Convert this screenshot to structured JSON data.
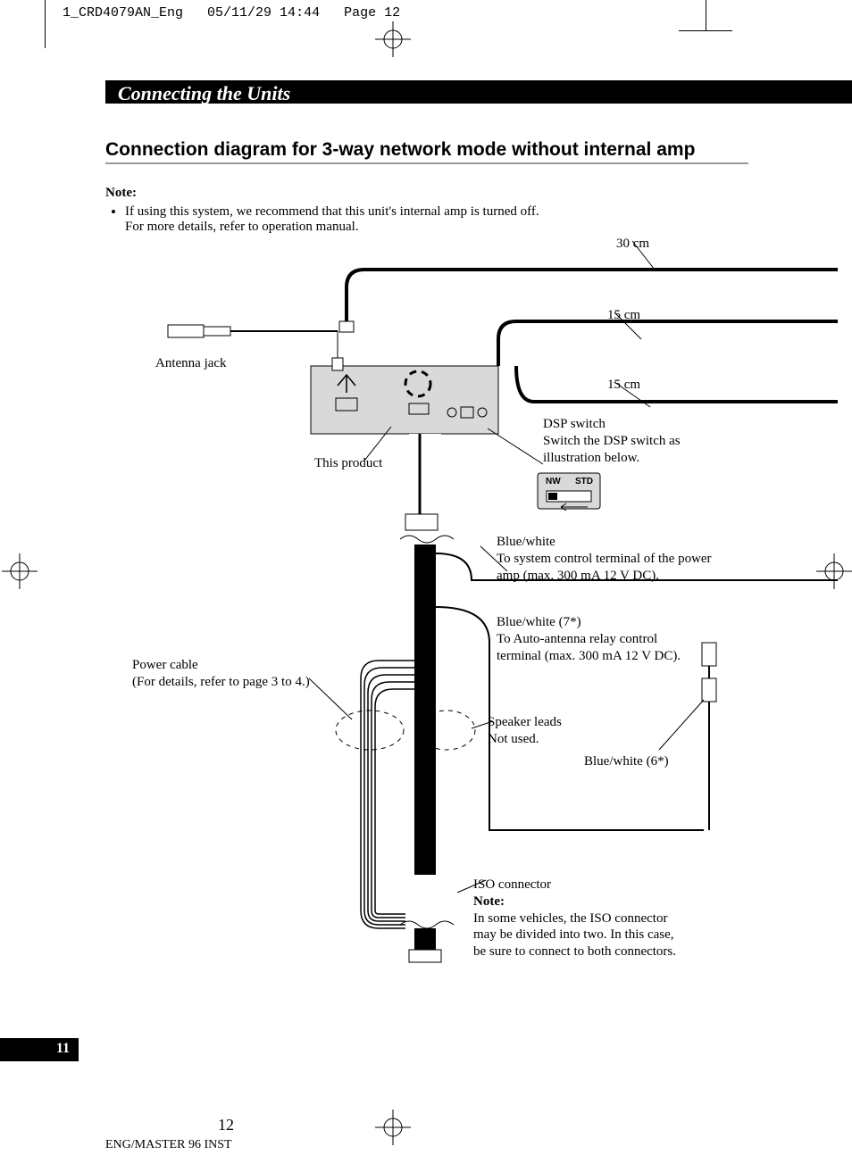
{
  "header": {
    "file": "1_CRD4079AN_Eng",
    "datetime": "05/11/29 14:44",
    "page": "Page 12"
  },
  "section_title": "Connecting the Units",
  "subheading": "Connection diagram for 3-way network mode without internal amp",
  "note": {
    "heading": "Note:",
    "bullet_line1": "If using this system, we recommend that this unit's internal amp is turned off.",
    "bullet_line2": "For more details, refer to operation manual."
  },
  "labels": {
    "len_30": "30 cm",
    "len_15a": "15 cm",
    "len_15b": "15 cm",
    "antenna": "Antenna jack",
    "this_product": "This product",
    "dsp1": "DSP switch",
    "dsp2": "Switch the DSP switch as",
    "dsp3": "illustration below.",
    "sw_nw": "NW",
    "sw_std": "STD",
    "bw1a": "Blue/white",
    "bw1b": "To system control terminal of the power",
    "bw1c": "amp (max. 300 mA 12 V DC).",
    "bw2a": "Blue/white (7*)",
    "bw2b": "To Auto-antenna relay control",
    "bw2c": "terminal (max. 300 mA 12 V DC).",
    "power1": "Power cable",
    "power2": "(For details, refer to page 3 to 4.)",
    "spk1": "Speaker leads",
    "spk2": "Not used.",
    "bw6": "Blue/white (6*)",
    "iso1": "ISO connector",
    "iso_nh": "Note:",
    "iso2": "In some vehicles, the ISO connector",
    "iso3": "may be divided into two. In this case,",
    "iso4": "be sure to connect to both connectors."
  },
  "page_number_side": "11",
  "page_number_bottom": "12",
  "footer": "ENG/MASTER 96 INST"
}
